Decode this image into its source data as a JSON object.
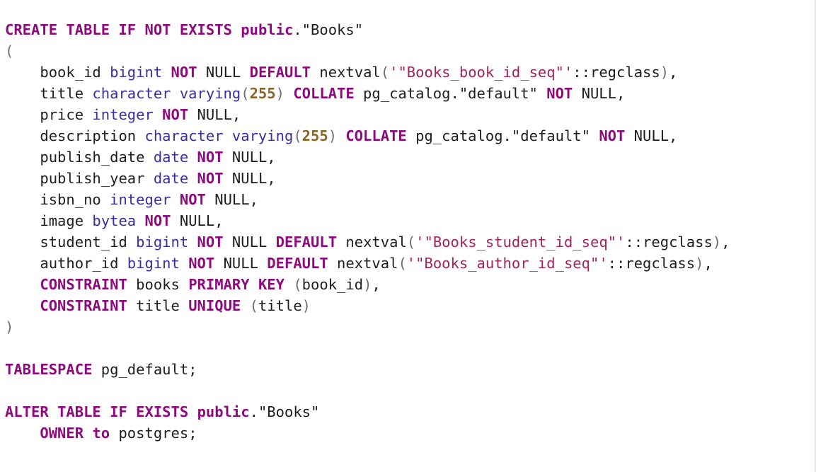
{
  "colors": {
    "background": "#ffffff",
    "keyword": "#8c0a7c",
    "type": "#3a2fa2",
    "string": "#a2235e",
    "number": "#8a6424",
    "punctuation": "#707070",
    "text": "#1e1e1e"
  },
  "code": {
    "lines": [
      {
        "tokens": [
          {
            "t": "CREATE",
            "c": "kw"
          },
          {
            "t": " ",
            "c": "plain"
          },
          {
            "t": "TABLE",
            "c": "kw"
          },
          {
            "t": " ",
            "c": "plain"
          },
          {
            "t": "IF",
            "c": "kw"
          },
          {
            "t": " ",
            "c": "plain"
          },
          {
            "t": "NOT",
            "c": "kw"
          },
          {
            "t": " ",
            "c": "plain"
          },
          {
            "t": "EXISTS",
            "c": "kw"
          },
          {
            "t": " ",
            "c": "plain"
          },
          {
            "t": "public",
            "c": "kw"
          },
          {
            "t": ".\"Books\"",
            "c": "plain"
          }
        ]
      },
      {
        "tokens": [
          {
            "t": "(",
            "c": "punc"
          }
        ]
      },
      {
        "tokens": [
          {
            "t": "    book_id ",
            "c": "plain"
          },
          {
            "t": "bigint",
            "c": "ty"
          },
          {
            "t": " ",
            "c": "plain"
          },
          {
            "t": "NOT",
            "c": "kw"
          },
          {
            "t": " NULL ",
            "c": "plain"
          },
          {
            "t": "DEFAULT",
            "c": "kw"
          },
          {
            "t": " nextval",
            "c": "plain"
          },
          {
            "t": "(",
            "c": "punc"
          },
          {
            "t": "'\"Books_book_id_seq\"'",
            "c": "str"
          },
          {
            "t": "::regclass",
            "c": "plain"
          },
          {
            "t": ")",
            "c": "punc"
          },
          {
            "t": ",",
            "c": "plain"
          }
        ]
      },
      {
        "tokens": [
          {
            "t": "    title ",
            "c": "plain"
          },
          {
            "t": "character varying",
            "c": "ty"
          },
          {
            "t": "(",
            "c": "punc"
          },
          {
            "t": "255",
            "c": "num"
          },
          {
            "t": ")",
            "c": "punc"
          },
          {
            "t": " ",
            "c": "plain"
          },
          {
            "t": "COLLATE",
            "c": "kw"
          },
          {
            "t": " pg_catalog.\"default\" ",
            "c": "plain"
          },
          {
            "t": "NOT",
            "c": "kw"
          },
          {
            "t": " NULL,",
            "c": "plain"
          }
        ]
      },
      {
        "tokens": [
          {
            "t": "    price ",
            "c": "plain"
          },
          {
            "t": "integer",
            "c": "ty"
          },
          {
            "t": " ",
            "c": "plain"
          },
          {
            "t": "NOT",
            "c": "kw"
          },
          {
            "t": " NULL,",
            "c": "plain"
          }
        ]
      },
      {
        "tokens": [
          {
            "t": "    description ",
            "c": "plain"
          },
          {
            "t": "character varying",
            "c": "ty"
          },
          {
            "t": "(",
            "c": "punc"
          },
          {
            "t": "255",
            "c": "num"
          },
          {
            "t": ")",
            "c": "punc"
          },
          {
            "t": " ",
            "c": "plain"
          },
          {
            "t": "COLLATE",
            "c": "kw"
          },
          {
            "t": " pg_catalog.\"default\" ",
            "c": "plain"
          },
          {
            "t": "NOT",
            "c": "kw"
          },
          {
            "t": " NULL,",
            "c": "plain"
          }
        ]
      },
      {
        "tokens": [
          {
            "t": "    publish_date ",
            "c": "plain"
          },
          {
            "t": "date",
            "c": "ty"
          },
          {
            "t": " ",
            "c": "plain"
          },
          {
            "t": "NOT",
            "c": "kw"
          },
          {
            "t": " NULL,",
            "c": "plain"
          }
        ]
      },
      {
        "tokens": [
          {
            "t": "    publish_year ",
            "c": "plain"
          },
          {
            "t": "date",
            "c": "ty"
          },
          {
            "t": " ",
            "c": "plain"
          },
          {
            "t": "NOT",
            "c": "kw"
          },
          {
            "t": " NULL,",
            "c": "plain"
          }
        ]
      },
      {
        "tokens": [
          {
            "t": "    isbn_no ",
            "c": "plain"
          },
          {
            "t": "integer",
            "c": "ty"
          },
          {
            "t": " ",
            "c": "plain"
          },
          {
            "t": "NOT",
            "c": "kw"
          },
          {
            "t": " NULL,",
            "c": "plain"
          }
        ]
      },
      {
        "tokens": [
          {
            "t": "    image ",
            "c": "plain"
          },
          {
            "t": "bytea",
            "c": "ty"
          },
          {
            "t": " ",
            "c": "plain"
          },
          {
            "t": "NOT",
            "c": "kw"
          },
          {
            "t": " NULL,",
            "c": "plain"
          }
        ]
      },
      {
        "tokens": [
          {
            "t": "    student_id ",
            "c": "plain"
          },
          {
            "t": "bigint",
            "c": "ty"
          },
          {
            "t": " ",
            "c": "plain"
          },
          {
            "t": "NOT",
            "c": "kw"
          },
          {
            "t": " NULL ",
            "c": "plain"
          },
          {
            "t": "DEFAULT",
            "c": "kw"
          },
          {
            "t": " nextval",
            "c": "plain"
          },
          {
            "t": "(",
            "c": "punc"
          },
          {
            "t": "'\"Books_student_id_seq\"'",
            "c": "str"
          },
          {
            "t": "::regclass",
            "c": "plain"
          },
          {
            "t": ")",
            "c": "punc"
          },
          {
            "t": ",",
            "c": "plain"
          }
        ]
      },
      {
        "tokens": [
          {
            "t": "    author_id ",
            "c": "plain"
          },
          {
            "t": "bigint",
            "c": "ty"
          },
          {
            "t": " ",
            "c": "plain"
          },
          {
            "t": "NOT",
            "c": "kw"
          },
          {
            "t": " NULL ",
            "c": "plain"
          },
          {
            "t": "DEFAULT",
            "c": "kw"
          },
          {
            "t": " nextval",
            "c": "plain"
          },
          {
            "t": "(",
            "c": "punc"
          },
          {
            "t": "'\"Books_author_id_seq\"'",
            "c": "str"
          },
          {
            "t": "::regclass",
            "c": "plain"
          },
          {
            "t": ")",
            "c": "punc"
          },
          {
            "t": ",",
            "c": "plain"
          }
        ]
      },
      {
        "tokens": [
          {
            "t": "    ",
            "c": "plain"
          },
          {
            "t": "CONSTRAINT",
            "c": "kw"
          },
          {
            "t": " books ",
            "c": "plain"
          },
          {
            "t": "PRIMARY",
            "c": "kw"
          },
          {
            "t": " ",
            "c": "plain"
          },
          {
            "t": "KEY",
            "c": "kw"
          },
          {
            "t": " ",
            "c": "plain"
          },
          {
            "t": "(",
            "c": "punc"
          },
          {
            "t": "book_id",
            "c": "plain"
          },
          {
            "t": ")",
            "c": "punc"
          },
          {
            "t": ",",
            "c": "plain"
          }
        ]
      },
      {
        "tokens": [
          {
            "t": "    ",
            "c": "plain"
          },
          {
            "t": "CONSTRAINT",
            "c": "kw"
          },
          {
            "t": " title ",
            "c": "plain"
          },
          {
            "t": "UNIQUE",
            "c": "kw"
          },
          {
            "t": " ",
            "c": "plain"
          },
          {
            "t": "(",
            "c": "punc"
          },
          {
            "t": "title",
            "c": "plain"
          },
          {
            "t": ")",
            "c": "punc"
          }
        ]
      },
      {
        "tokens": [
          {
            "t": ")",
            "c": "punc"
          }
        ]
      },
      {
        "tokens": [
          {
            "t": "",
            "c": "plain"
          }
        ]
      },
      {
        "tokens": [
          {
            "t": "TABLESPACE",
            "c": "kw"
          },
          {
            "t": " pg_default;",
            "c": "plain"
          }
        ]
      },
      {
        "tokens": [
          {
            "t": "",
            "c": "plain"
          }
        ]
      },
      {
        "tokens": [
          {
            "t": "ALTER",
            "c": "kw"
          },
          {
            "t": " ",
            "c": "plain"
          },
          {
            "t": "TABLE",
            "c": "kw"
          },
          {
            "t": " ",
            "c": "plain"
          },
          {
            "t": "IF",
            "c": "kw"
          },
          {
            "t": " ",
            "c": "plain"
          },
          {
            "t": "EXISTS",
            "c": "kw"
          },
          {
            "t": " ",
            "c": "plain"
          },
          {
            "t": "public",
            "c": "kw"
          },
          {
            "t": ".\"Books\"",
            "c": "plain"
          }
        ]
      },
      {
        "tokens": [
          {
            "t": "    ",
            "c": "plain"
          },
          {
            "t": "OWNER",
            "c": "kw"
          },
          {
            "t": " ",
            "c": "plain"
          },
          {
            "t": "to",
            "c": "kw"
          },
          {
            "t": " postgres;",
            "c": "plain"
          }
        ]
      }
    ]
  }
}
